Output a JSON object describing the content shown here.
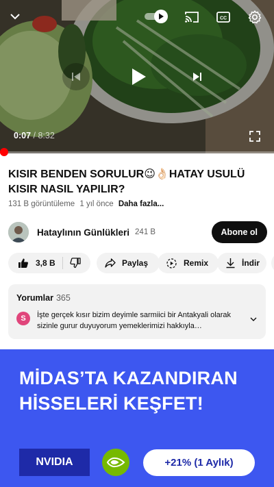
{
  "player": {
    "current_time": "0:07",
    "separator": " / ",
    "duration": "8:32",
    "progress_fraction": 0.014,
    "autoplay_on": true,
    "icons": {
      "minimize": "chevron-down-icon",
      "autoplay": "autoplay-toggle-icon",
      "cast": "cast-icon",
      "captions": "captions-icon",
      "settings": "gear-icon",
      "previous": "skip-previous-icon",
      "play": "play-icon",
      "next": "skip-next-icon",
      "fullscreen": "fullscreen-icon"
    }
  },
  "video": {
    "title": "KISIR BENDEN SORULUR😉👌🏻HATAY USULÜ KISIR NASIL YAPILIR?",
    "views": "131 B görüntüleme",
    "age": "1 yıl önce",
    "more_label": "Daha fazla..."
  },
  "channel": {
    "name": "Hataylının Günlükleri",
    "subscribers": "241 B",
    "subscribe_label": "Abone ol"
  },
  "actions": {
    "like_count": "3,8 B",
    "share_label": "Paylaş",
    "remix_label": "Remix",
    "download_label": "İndir"
  },
  "comments": {
    "header": "Yorumlar",
    "count": "365",
    "avatar_letter": "S",
    "avatar_color": "#e0457b",
    "top_comment": "İşte gerçek kısır bizim deyimle sarmiici bir Antakyali olarak sizinle gurur duyuyorum yemeklerimizi hakkıyla tanıtıyorsunuz"
  },
  "ad": {
    "headline": "MİDAS’TA KAZANDIRAN HİSSELERİ KEŞFET!",
    "stock_name": "NVIDIA",
    "change_label": "+21% (1 Aylık)",
    "colors": {
      "background": "#3d57f0",
      "label_bg": "#1e2aa8",
      "logo": "#76b900"
    }
  },
  "colors": {
    "accent": "#ff0000",
    "text_primary": "#0f0f0f",
    "text_secondary": "#606060",
    "chip_bg": "#f2f2f2"
  }
}
